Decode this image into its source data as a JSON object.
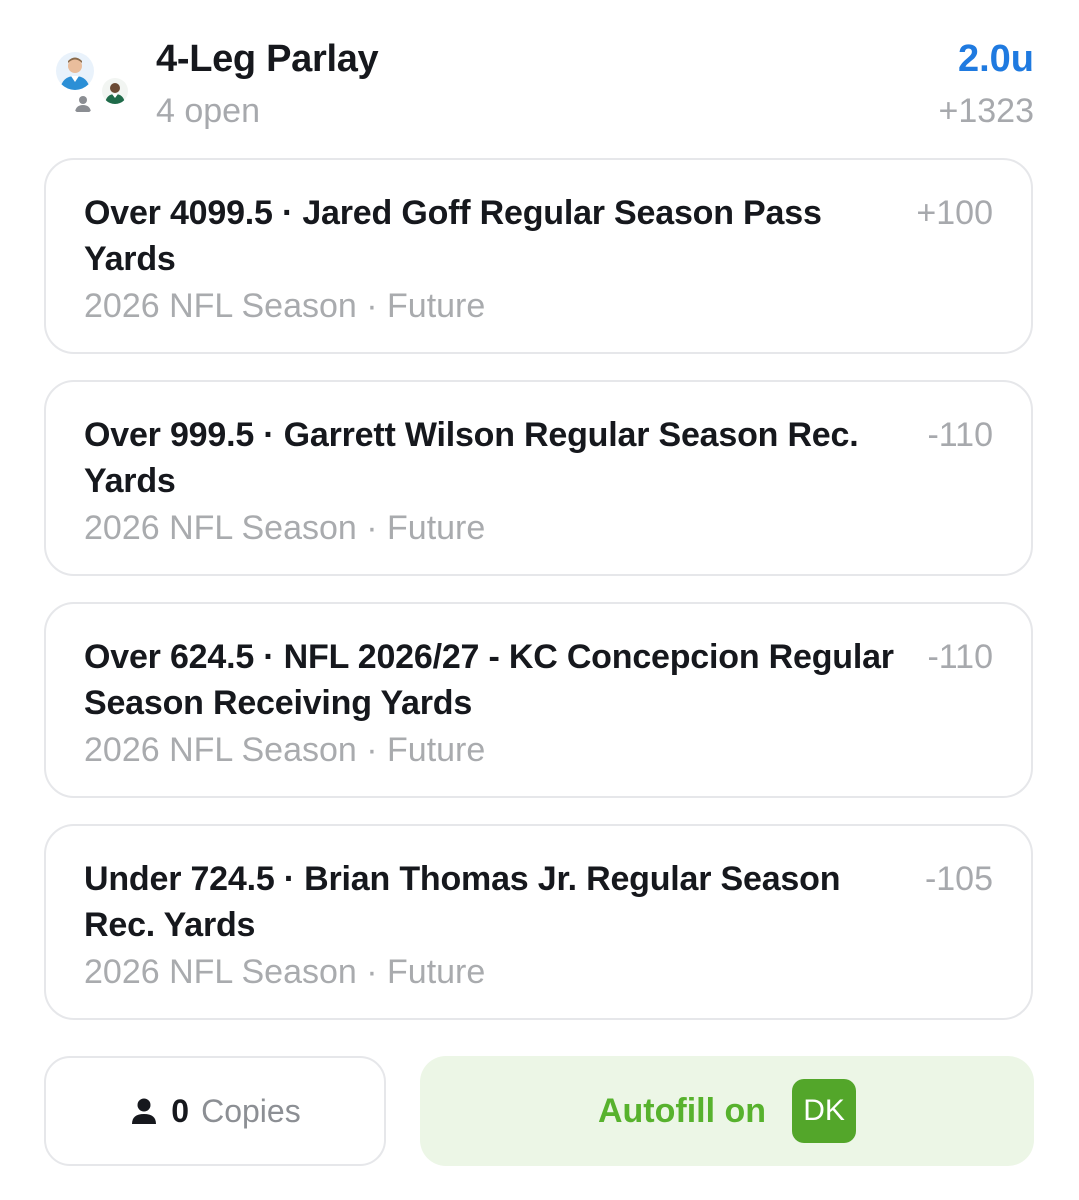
{
  "header": {
    "title": "4-Leg Parlay",
    "subtitle": "4 open",
    "units": "2.0u",
    "odds": "+1323"
  },
  "legs": [
    {
      "line": "Over 4099.5 · Jared Goff Regular Season Pass Yards",
      "odds": "+100",
      "sub": "2026 NFL Season · Future"
    },
    {
      "line": "Over 999.5 · Garrett Wilson Regular Season Rec. Yards",
      "odds": "-110",
      "sub": "2026 NFL Season · Future"
    },
    {
      "line": "Over 624.5 · NFL 2026/27 - KC Concepcion Regular Season Receiving Yards",
      "odds": "-110",
      "sub": "2026 NFL Season · Future"
    },
    {
      "line": "Under 724.5 · Brian Thomas Jr. Regular Season Rec. Yards",
      "odds": "-105",
      "sub": "2026 NFL Season · Future"
    }
  ],
  "footer": {
    "copies_count": "0",
    "copies_label": "Copies",
    "autofill_label": "Autofill on",
    "dk_badge": "DK"
  },
  "colors": {
    "accent": "#1f7ae0",
    "autofill_green": "#57b22d",
    "dk_green": "#53a62a"
  },
  "icons": {
    "avatars": [
      "player-avatar-icon",
      "user-placeholder-icon",
      "player-avatar-icon"
    ],
    "copies": "person-icon"
  }
}
